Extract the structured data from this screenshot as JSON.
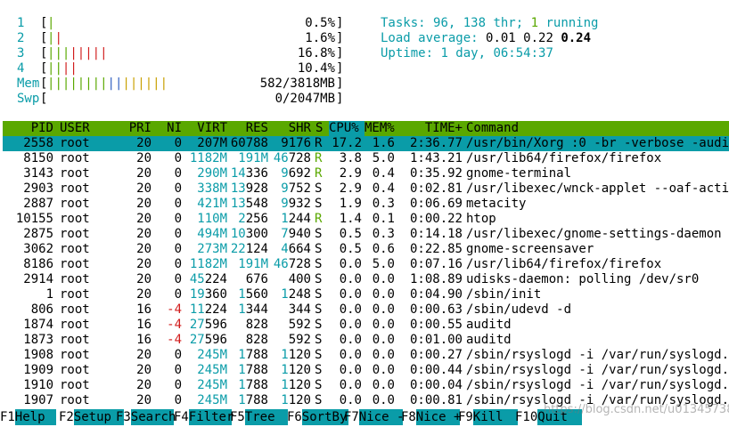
{
  "meters": {
    "cpu": [
      {
        "label": "1",
        "value": "0.5%",
        "bars": "|",
        "bar_colors": [
          "green"
        ]
      },
      {
        "label": "2",
        "value": "1.6%",
        "bars": "||",
        "bar_colors": [
          "green",
          "red"
        ]
      },
      {
        "label": "3",
        "value": "16.8%",
        "bars": "||||||||",
        "bar_colors": [
          "green",
          "green",
          "green",
          "red",
          "red",
          "red",
          "red",
          "red"
        ]
      },
      {
        "label": "4",
        "value": "10.4%",
        "bars": "||||",
        "bar_colors": [
          "green",
          "green",
          "red",
          "red"
        ]
      }
    ],
    "mem": {
      "label": "Mem",
      "value": "582/3818MB",
      "bars": "||||||||||||||||"
    },
    "swp": {
      "label": "Swp",
      "value": "0/2047MB"
    }
  },
  "summary": {
    "tasks_label": "Tasks: ",
    "tasks": "96, 138 thr; ",
    "running_count": "1",
    "running_label": " running",
    "load_label": "Load average: ",
    "load1": "0.01",
    "load5": "0.22",
    "load15": "0.24",
    "uptime_label": "Uptime: ",
    "uptime": "1 day, 06:54:37"
  },
  "columns": [
    "PID",
    "USER",
    "PRI",
    "NI",
    "VIRT",
    "RES",
    "SHR",
    "S",
    "CPU%",
    "MEM%",
    "TIME+",
    "Command"
  ],
  "sorted_column": "CPU%",
  "processes": [
    {
      "pid": "2558",
      "user": "root",
      "pri": "20",
      "ni": "0",
      "virt": "207M",
      "res": "60788",
      "shr": "9176",
      "s": "R",
      "cpu": "17.2",
      "mem": "1.6",
      "time": "2:36.77",
      "cmd": "/usr/bin/Xorg :0 -br -verbose -audit",
      "selected": true
    },
    {
      "pid": "8150",
      "user": "root",
      "pri": "20",
      "ni": "0",
      "virt": "1182M",
      "res": "191M",
      "shr": "46728",
      "s": "R",
      "cpu": "3.8",
      "mem": "5.0",
      "time": "1:43.21",
      "cmd": "/usr/lib64/firefox/firefox"
    },
    {
      "pid": "3143",
      "user": "root",
      "pri": "20",
      "ni": "0",
      "virt": "290M",
      "res": "14336",
      "shr": "9692",
      "s": "R",
      "cpu": "2.9",
      "mem": "0.4",
      "time": "0:35.92",
      "cmd": "gnome-terminal"
    },
    {
      "pid": "2903",
      "user": "root",
      "pri": "20",
      "ni": "0",
      "virt": "338M",
      "res": "13928",
      "shr": "9752",
      "s": "S",
      "cpu": "2.9",
      "mem": "0.4",
      "time": "0:02.81",
      "cmd": "/usr/libexec/wnck-applet --oaf-activa"
    },
    {
      "pid": "2887",
      "user": "root",
      "pri": "20",
      "ni": "0",
      "virt": "421M",
      "res": "13548",
      "shr": "9932",
      "s": "S",
      "cpu": "1.9",
      "mem": "0.3",
      "time": "0:06.69",
      "cmd": "metacity"
    },
    {
      "pid": "10155",
      "user": "root",
      "pri": "20",
      "ni": "0",
      "virt": "110M",
      "res": "2256",
      "shr": "1244",
      "s": "R",
      "cpu": "1.4",
      "mem": "0.1",
      "time": "0:00.22",
      "cmd": "htop"
    },
    {
      "pid": "2875",
      "user": "root",
      "pri": "20",
      "ni": "0",
      "virt": "494M",
      "res": "10300",
      "shr": "7940",
      "s": "S",
      "cpu": "0.5",
      "mem": "0.3",
      "time": "0:14.18",
      "cmd": "/usr/libexec/gnome-settings-daemon"
    },
    {
      "pid": "3062",
      "user": "root",
      "pri": "20",
      "ni": "0",
      "virt": "273M",
      "res": "22124",
      "shr": "4664",
      "s": "S",
      "cpu": "0.5",
      "mem": "0.6",
      "time": "0:22.85",
      "cmd": "gnome-screensaver"
    },
    {
      "pid": "8186",
      "user": "root",
      "pri": "20",
      "ni": "0",
      "virt": "1182M",
      "res": "191M",
      "shr": "46728",
      "s": "S",
      "cpu": "0.0",
      "mem": "5.0",
      "time": "0:07.16",
      "cmd": "/usr/lib64/firefox/firefox"
    },
    {
      "pid": "2914",
      "user": "root",
      "pri": "20",
      "ni": "0",
      "virt": "45224",
      "res": "676",
      "shr": "400",
      "s": "S",
      "cpu": "0.0",
      "mem": "0.0",
      "time": "1:08.89",
      "cmd": "udisks-daemon: polling /dev/sr0"
    },
    {
      "pid": "1",
      "user": "root",
      "pri": "20",
      "ni": "0",
      "virt": "19360",
      "res": "1560",
      "shr": "1248",
      "s": "S",
      "cpu": "0.0",
      "mem": "0.0",
      "time": "0:04.90",
      "cmd": "/sbin/init"
    },
    {
      "pid": "806",
      "user": "root",
      "pri": "16",
      "ni": "-4",
      "virt": "11224",
      "res": "1344",
      "shr": "344",
      "s": "S",
      "cpu": "0.0",
      "mem": "0.0",
      "time": "0:00.63",
      "cmd": "/sbin/udevd -d"
    },
    {
      "pid": "1874",
      "user": "root",
      "pri": "16",
      "ni": "-4",
      "virt": "27596",
      "res": "828",
      "shr": "592",
      "s": "S",
      "cpu": "0.0",
      "mem": "0.0",
      "time": "0:00.55",
      "cmd": "auditd"
    },
    {
      "pid": "1873",
      "user": "root",
      "pri": "16",
      "ni": "-4",
      "virt": "27596",
      "res": "828",
      "shr": "592",
      "s": "S",
      "cpu": "0.0",
      "mem": "0.0",
      "time": "0:01.00",
      "cmd": "auditd"
    },
    {
      "pid": "1908",
      "user": "root",
      "pri": "20",
      "ni": "0",
      "virt": "245M",
      "res": "1788",
      "shr": "1120",
      "s": "S",
      "cpu": "0.0",
      "mem": "0.0",
      "time": "0:00.27",
      "cmd": "/sbin/rsyslogd -i /var/run/syslogd.pi"
    },
    {
      "pid": "1909",
      "user": "root",
      "pri": "20",
      "ni": "0",
      "virt": "245M",
      "res": "1788",
      "shr": "1120",
      "s": "S",
      "cpu": "0.0",
      "mem": "0.0",
      "time": "0:00.44",
      "cmd": "/sbin/rsyslogd -i /var/run/syslogd.pi"
    },
    {
      "pid": "1910",
      "user": "root",
      "pri": "20",
      "ni": "0",
      "virt": "245M",
      "res": "1788",
      "shr": "1120",
      "s": "S",
      "cpu": "0.0",
      "mem": "0.0",
      "time": "0:00.04",
      "cmd": "/sbin/rsyslogd -i /var/run/syslogd.pi"
    },
    {
      "pid": "1907",
      "user": "root",
      "pri": "20",
      "ni": "0",
      "virt": "245M",
      "res": "1788",
      "shr": "1120",
      "s": "S",
      "cpu": "0.0",
      "mem": "0.0",
      "time": "0:00.81",
      "cmd": "/sbin/rsyslogd -i /var/run/syslogd.pi"
    }
  ],
  "footer": [
    {
      "key": "F1",
      "label": "Help"
    },
    {
      "key": "F2",
      "label": "Setup"
    },
    {
      "key": "F3",
      "label": "Search"
    },
    {
      "key": "F4",
      "label": "Filter"
    },
    {
      "key": "F5",
      "label": "Tree"
    },
    {
      "key": "F6",
      "label": "SortBy"
    },
    {
      "key": "F7",
      "label": "Nice -"
    },
    {
      "key": "F8",
      "label": "Nice +"
    },
    {
      "key": "F9",
      "label": "Kill"
    },
    {
      "key": "F10",
      "label": "Quit"
    }
  ],
  "watermark": "https://blog.csdn.net/u013457387",
  "colors": {
    "green": "#5aa800",
    "teal": "#0a9ca8",
    "red": "#d11d1d"
  }
}
